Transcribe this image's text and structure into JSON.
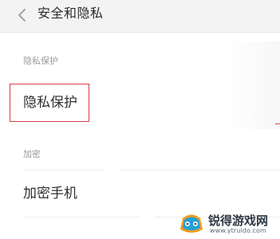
{
  "header": {
    "back_icon": "chevron-left-icon",
    "title": "安全和隐私"
  },
  "sections": {
    "privacy": {
      "label": "隐私保护",
      "item": "隐私保护",
      "selected_outline_color": "#d7404a"
    },
    "encrypt": {
      "label": "加密",
      "item": "加密手机"
    }
  },
  "watermark": {
    "icon": "gamepad-logo-icon",
    "title": "锐得游戏网",
    "url": "www.ytruido.com"
  }
}
